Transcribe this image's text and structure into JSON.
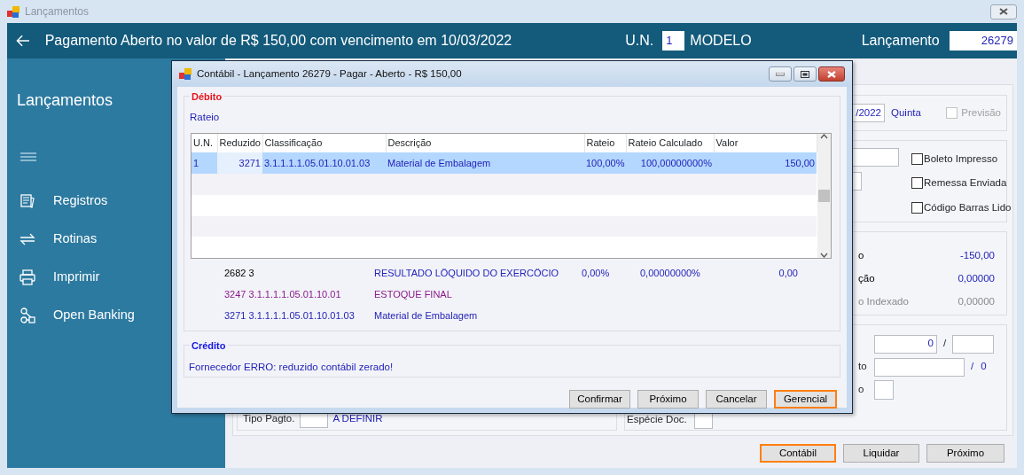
{
  "window": {
    "title": "Lançamentos"
  },
  "header": {
    "title": "Pagamento Aberto no valor de R$ 150,00 com vencimento em 10/03/2022",
    "un_label": "U.N.",
    "un_value": "1",
    "un_name": "MODELO",
    "entry_label": "Lançamento",
    "entry_value": "26279"
  },
  "sidebar": {
    "title": "Lançamentos",
    "items": [
      {
        "kind": "records",
        "label": "Registros"
      },
      {
        "kind": "routines",
        "label": "Rotinas"
      },
      {
        "kind": "print",
        "label": "Imprimir"
      },
      {
        "kind": "banking",
        "label": "Open Banking"
      }
    ]
  },
  "form": {
    "date_fragment": "/2022",
    "weekday": "Quinta",
    "forecast": {
      "label": "Previsão",
      "checked": false,
      "disabled": true
    },
    "flags": [
      {
        "label": "Boleto Impresso",
        "checked": false
      },
      {
        "label": "Remessa Enviada",
        "checked": false
      },
      {
        "label": "Código Barras Lido",
        "checked": false
      }
    ],
    "totals": [
      {
        "label": "o",
        "value": "-150,00",
        "muted": false
      },
      {
        "label": "ção",
        "value": "0,00000",
        "muted": false
      },
      {
        "label": "o Indexado",
        "value": "0,00000",
        "muted": true
      }
    ],
    "installment": {
      "value": "0",
      "separator": "/"
    },
    "document": {
      "label": "to",
      "separator": "/",
      "total": "0"
    },
    "last_row": {
      "label": "o"
    },
    "payment_type": {
      "label": "Tipo Pagto.",
      "value": "A DEFINIR"
    },
    "doc_kind": {
      "label": "Espécie Doc."
    }
  },
  "buttons": [
    {
      "label": "Contábil",
      "focused": true
    },
    {
      "label": "Liquidar",
      "focused": false
    },
    {
      "label": "Próximo",
      "focused": false
    }
  ],
  "dialog": {
    "title": "Contábil - Lançamento 26279 - Pagar - Aberto - R$ 150,00",
    "debit": {
      "title": "Débito",
      "subtitle": "Rateio",
      "columns": [
        "U.N.",
        "Reduzido",
        "Classificação",
        "Descrição",
        "Rateio",
        "Rateio Calculado",
        "Valor"
      ],
      "rows": [
        {
          "selected": true,
          "cells": [
            "1",
            "3271",
            "3.1.1.1.1.05.01.10.01.03",
            "Material de Embalagem",
            "100,00%",
            "100,00000000%",
            "150,00"
          ]
        }
      ],
      "summary": [
        {
          "kind": "result",
          "code": "2682 3",
          "description": "RESULTADO LÖQUIDO DO EXERCÖCIO",
          "rateio": "0,00%",
          "calculated": "0,00000000%",
          "value": "0,00"
        },
        {
          "kind": "parent",
          "code": "3247 3.1.1.1.1.05.01.10.01",
          "description": "ESTOQUE FINAL"
        },
        {
          "kind": "account",
          "code": "3271 3.1.1.1.1.05.01.10.01.03",
          "description": "Material de Embalagem"
        }
      ]
    },
    "credit": {
      "title": "Crédito",
      "message": "Fornecedor ERRO: reduzido contábil zerado!"
    },
    "buttons": [
      {
        "label": "Confirmar",
        "focused": false
      },
      {
        "label": "Próximo",
        "focused": false
      },
      {
        "label": "Cancelar",
        "focused": false
      },
      {
        "label": "Gerencial",
        "focused": true
      }
    ]
  }
}
